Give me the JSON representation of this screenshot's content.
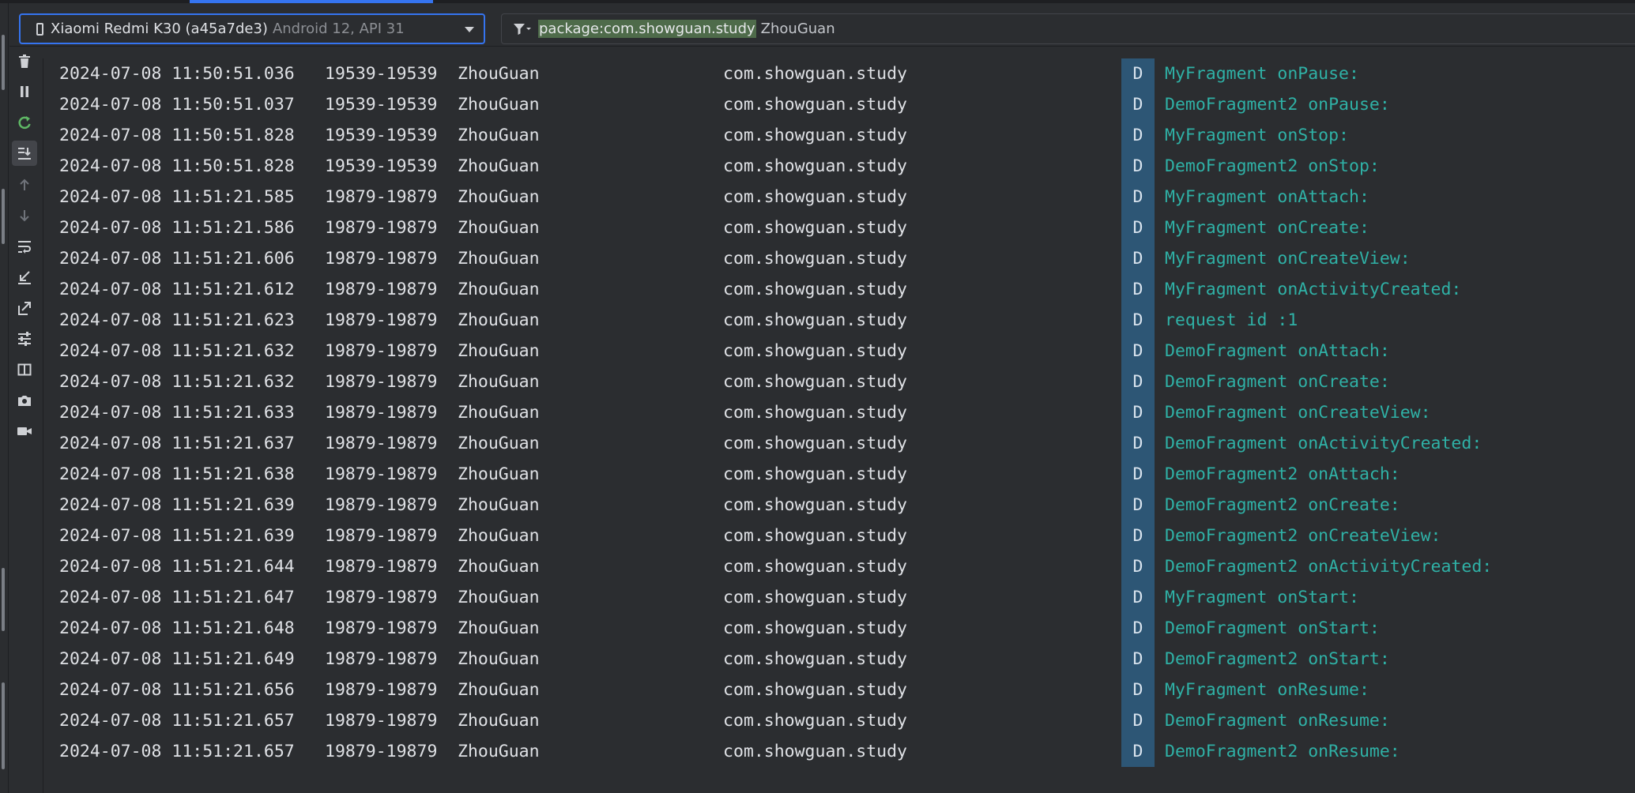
{
  "device_selector": {
    "device_name": "Xiaomi Redmi K30 (a45a7de3)",
    "api_label": "Android 12, API 31"
  },
  "filter": {
    "package_query": "package:com.showguan.study",
    "tag_query": "ZhouGuan"
  },
  "toolbar": {
    "icons": [
      "trash-icon",
      "pause-icon",
      "restart-icon",
      "scroll-to-end-icon",
      "up-arrow-icon",
      "down-arrow-icon",
      "soft-wrap-icon",
      "import-icon",
      "export-icon",
      "settings-sliders-icon",
      "split-panels-icon",
      "camera-icon",
      "video-icon"
    ]
  },
  "colors": {
    "accent": "#3574f0",
    "message_text": "#2fb1a6",
    "level_badge": "#2d5675",
    "filter_highlight": "#4e6b4a"
  },
  "logs": [
    {
      "time": "2024-07-08 11:50:51.036",
      "pid": "19539-19539",
      "tag": "ZhouGuan",
      "package": "com.showguan.study",
      "level": "D",
      "message": "MyFragment onPause:"
    },
    {
      "time": "2024-07-08 11:50:51.037",
      "pid": "19539-19539",
      "tag": "ZhouGuan",
      "package": "com.showguan.study",
      "level": "D",
      "message": "DemoFragment2 onPause:"
    },
    {
      "time": "2024-07-08 11:50:51.828",
      "pid": "19539-19539",
      "tag": "ZhouGuan",
      "package": "com.showguan.study",
      "level": "D",
      "message": "MyFragment onStop:"
    },
    {
      "time": "2024-07-08 11:50:51.828",
      "pid": "19539-19539",
      "tag": "ZhouGuan",
      "package": "com.showguan.study",
      "level": "D",
      "message": "DemoFragment2 onStop:"
    },
    {
      "time": "2024-07-08 11:51:21.585",
      "pid": "19879-19879",
      "tag": "ZhouGuan",
      "package": "com.showguan.study",
      "level": "D",
      "message": "MyFragment onAttach:"
    },
    {
      "time": "2024-07-08 11:51:21.586",
      "pid": "19879-19879",
      "tag": "ZhouGuan",
      "package": "com.showguan.study",
      "level": "D",
      "message": "MyFragment onCreate:"
    },
    {
      "time": "2024-07-08 11:51:21.606",
      "pid": "19879-19879",
      "tag": "ZhouGuan",
      "package": "com.showguan.study",
      "level": "D",
      "message": "MyFragment onCreateView:"
    },
    {
      "time": "2024-07-08 11:51:21.612",
      "pid": "19879-19879",
      "tag": "ZhouGuan",
      "package": "com.showguan.study",
      "level": "D",
      "message": "MyFragment onActivityCreated:"
    },
    {
      "time": "2024-07-08 11:51:21.623",
      "pid": "19879-19879",
      "tag": "ZhouGuan",
      "package": "com.showguan.study",
      "level": "D",
      "message": "request id :1"
    },
    {
      "time": "2024-07-08 11:51:21.632",
      "pid": "19879-19879",
      "tag": "ZhouGuan",
      "package": "com.showguan.study",
      "level": "D",
      "message": "DemoFragment onAttach:"
    },
    {
      "time": "2024-07-08 11:51:21.632",
      "pid": "19879-19879",
      "tag": "ZhouGuan",
      "package": "com.showguan.study",
      "level": "D",
      "message": "DemoFragment onCreate:"
    },
    {
      "time": "2024-07-08 11:51:21.633",
      "pid": "19879-19879",
      "tag": "ZhouGuan",
      "package": "com.showguan.study",
      "level": "D",
      "message": "DemoFragment onCreateView:"
    },
    {
      "time": "2024-07-08 11:51:21.637",
      "pid": "19879-19879",
      "tag": "ZhouGuan",
      "package": "com.showguan.study",
      "level": "D",
      "message": "DemoFragment onActivityCreated:"
    },
    {
      "time": "2024-07-08 11:51:21.638",
      "pid": "19879-19879",
      "tag": "ZhouGuan",
      "package": "com.showguan.study",
      "level": "D",
      "message": "DemoFragment2 onAttach:"
    },
    {
      "time": "2024-07-08 11:51:21.639",
      "pid": "19879-19879",
      "tag": "ZhouGuan",
      "package": "com.showguan.study",
      "level": "D",
      "message": "DemoFragment2 onCreate:"
    },
    {
      "time": "2024-07-08 11:51:21.639",
      "pid": "19879-19879",
      "tag": "ZhouGuan",
      "package": "com.showguan.study",
      "level": "D",
      "message": "DemoFragment2 onCreateView:"
    },
    {
      "time": "2024-07-08 11:51:21.644",
      "pid": "19879-19879",
      "tag": "ZhouGuan",
      "package": "com.showguan.study",
      "level": "D",
      "message": "DemoFragment2 onActivityCreated:"
    },
    {
      "time": "2024-07-08 11:51:21.647",
      "pid": "19879-19879",
      "tag": "ZhouGuan",
      "package": "com.showguan.study",
      "level": "D",
      "message": "MyFragment onStart:"
    },
    {
      "time": "2024-07-08 11:51:21.648",
      "pid": "19879-19879",
      "tag": "ZhouGuan",
      "package": "com.showguan.study",
      "level": "D",
      "message": "DemoFragment onStart:"
    },
    {
      "time": "2024-07-08 11:51:21.649",
      "pid": "19879-19879",
      "tag": "ZhouGuan",
      "package": "com.showguan.study",
      "level": "D",
      "message": "DemoFragment2 onStart:"
    },
    {
      "time": "2024-07-08 11:51:21.656",
      "pid": "19879-19879",
      "tag": "ZhouGuan",
      "package": "com.showguan.study",
      "level": "D",
      "message": "MyFragment onResume:"
    },
    {
      "time": "2024-07-08 11:51:21.657",
      "pid": "19879-19879",
      "tag": "ZhouGuan",
      "package": "com.showguan.study",
      "level": "D",
      "message": "DemoFragment onResume:"
    },
    {
      "time": "2024-07-08 11:51:21.657",
      "pid": "19879-19879",
      "tag": "ZhouGuan",
      "package": "com.showguan.study",
      "level": "D",
      "message": "DemoFragment2 onResume:"
    }
  ]
}
